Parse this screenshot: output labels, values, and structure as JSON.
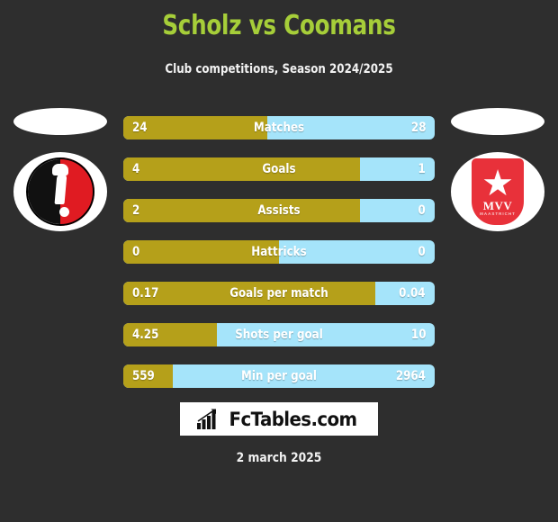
{
  "header": {
    "title": "Scholz vs Coomans",
    "subtitle": "Club competitions, Season 2024/2025",
    "title_color": "#a6ce39"
  },
  "teams": {
    "left": {
      "crest_name": "ajax-crest",
      "colors": [
        "#111111",
        "#e01b22"
      ]
    },
    "right": {
      "crest_name": "mvv-maastricht-crest",
      "text": "MVV",
      "subtext": "MAASTRICHT",
      "colors": [
        "#e8313a",
        "#ffffff"
      ]
    }
  },
  "chart_data": {
    "type": "bar",
    "title": "Scholz vs Coomans",
    "subtitle": "Club competitions, Season 2024/2025",
    "orientation": "horizontal-diverging",
    "categories": [
      "Matches",
      "Goals",
      "Assists",
      "Hattricks",
      "Goals per match",
      "Shots per goal",
      "Min per goal"
    ],
    "series": [
      {
        "name": "Scholz",
        "color": "#b5a01a",
        "values": [
          "24",
          "4",
          "2",
          "0",
          "0.17",
          "4.25",
          "559"
        ]
      },
      {
        "name": "Coomans",
        "color": "#a5e4fa",
        "values": [
          "28",
          "1",
          "0",
          "0",
          "0.04",
          "10",
          "2964"
        ]
      }
    ],
    "left_fill_percent": [
      46.2,
      76.0,
      76.0,
      50.0,
      81.0,
      30.0,
      16.0
    ],
    "legend": "none",
    "grid": false
  },
  "rows": [
    {
      "label": "Matches",
      "left": "24",
      "right": "28",
      "fill": 46.2
    },
    {
      "label": "Goals",
      "left": "4",
      "right": "1",
      "fill": 76.0
    },
    {
      "label": "Assists",
      "left": "2",
      "right": "0",
      "fill": 76.0
    },
    {
      "label": "Hattricks",
      "left": "0",
      "right": "0",
      "fill": 50.0
    },
    {
      "label": "Goals per match",
      "left": "0.17",
      "right": "0.04",
      "fill": 81.0
    },
    {
      "label": "Shots per goal",
      "left": "4.25",
      "right": "10",
      "fill": 30.0
    },
    {
      "label": "Min per goal",
      "left": "559",
      "right": "2964",
      "fill": 16.0
    }
  ],
  "footer": {
    "logo_text": "FcTables.com",
    "logo_icon": "bar-chart-trend-icon",
    "date": "2 march 2025"
  }
}
